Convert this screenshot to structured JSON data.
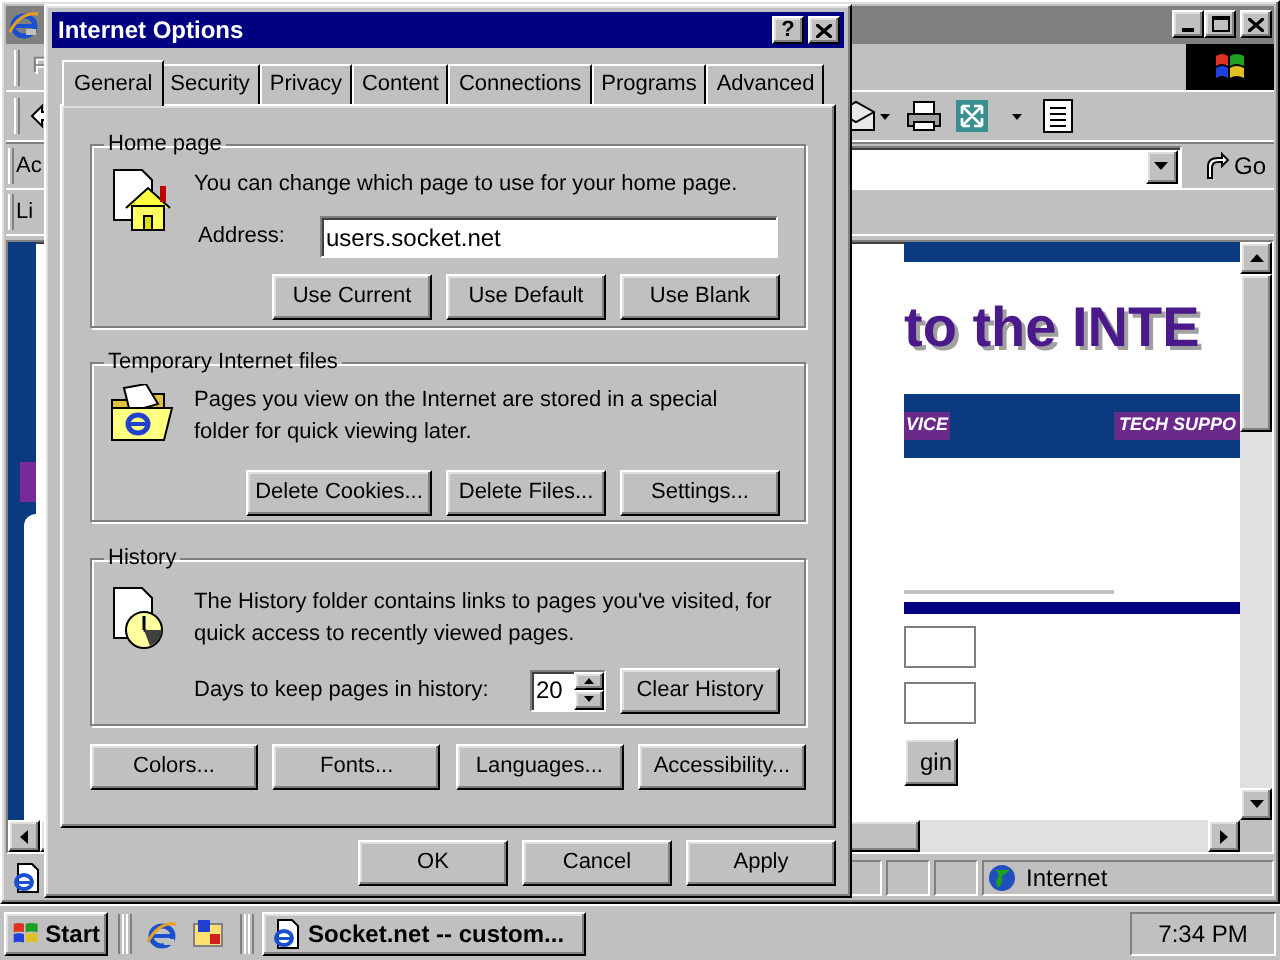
{
  "browser": {
    "menu_bar": {
      "items": [
        "F"
      ]
    },
    "address_bar": {
      "label": "Ac",
      "go_button": "Go"
    },
    "links_bar": {
      "label": "Li"
    },
    "page": {
      "banner": "to the INTE",
      "nav": [
        "VICE",
        "TECH SUPPO"
      ],
      "login_button": "gin"
    },
    "status_bar": {
      "zone": "Internet"
    }
  },
  "dialog": {
    "title": "Internet Options",
    "help_button": "?",
    "tabs": [
      {
        "label": "General",
        "selected": true
      },
      {
        "label": "Security",
        "selected": false
      },
      {
        "label": "Privacy",
        "selected": false
      },
      {
        "label": "Content",
        "selected": false
      },
      {
        "label": "Connections",
        "selected": false
      },
      {
        "label": "Programs",
        "selected": false
      },
      {
        "label": "Advanced",
        "selected": false
      }
    ],
    "home_page": {
      "title": "Home page",
      "description": "You can change which page to use for your home page.",
      "address_label": "Address:",
      "address_value": "users.socket.net",
      "buttons": [
        "Use Current",
        "Use Default",
        "Use Blank"
      ]
    },
    "temporary_files": {
      "title": "Temporary Internet files",
      "description": "Pages you view on the Internet are stored in a special folder for quick viewing later.",
      "buttons": [
        "Delete Cookies...",
        "Delete Files...",
        "Settings..."
      ]
    },
    "history": {
      "title": "History",
      "description": "The History folder contains links to pages you've visited, for quick access to recently viewed pages.",
      "days_label": "Days to keep pages in history:",
      "days_value": "20",
      "button": "Clear History"
    },
    "bottom_buttons": [
      "Colors...",
      "Fonts...",
      "Languages...",
      "Accessibility..."
    ],
    "footer_buttons": [
      "OK",
      "Cancel",
      "Apply"
    ]
  },
  "taskbar": {
    "start": "Start",
    "tasks": [
      "Socket.net -- custom..."
    ],
    "clock": "7:34 PM"
  }
}
